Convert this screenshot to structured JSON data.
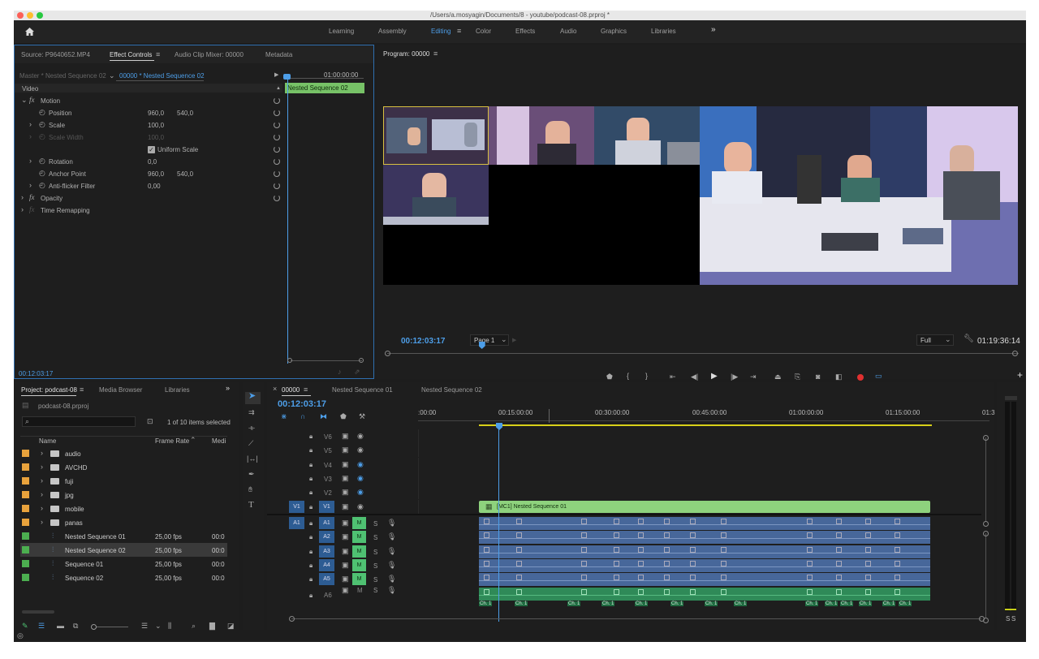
{
  "window": {
    "title": "/Users/a.mosyagin/Documents/8 - youtube/podcast-08.prproj *"
  },
  "workspaces": {
    "items": [
      "Learning",
      "Assembly",
      "Editing",
      "Color",
      "Effects",
      "Audio",
      "Graphics",
      "Libraries"
    ],
    "active": "Editing",
    "more": "»"
  },
  "source_panel": {
    "tabs": [
      "Source: P9640652.MP4",
      "Effect Controls",
      "Audio Clip Mixer: 00000",
      "Metadata"
    ],
    "active_tab": "Effect Controls",
    "master_label": "Master * Nested Sequence 02",
    "sequence_label": "00000 * Nested Sequence 02",
    "ruler_time": "01:00:00:00",
    "clip_label": "Nested Sequence 02",
    "video_header": "Video",
    "motion": "Motion",
    "properties": [
      {
        "name": "Position",
        "v1": "960,0",
        "v2": "540,0"
      },
      {
        "name": "Scale",
        "v1": "100,0",
        "v2": ""
      },
      {
        "name": "Scale Width",
        "v1": "100,0",
        "v2": ""
      },
      {
        "name": "Rotation",
        "v1": "0,0",
        "v2": ""
      },
      {
        "name": "Anchor Point",
        "v1": "960,0",
        "v2": "540,0"
      },
      {
        "name": "Anti-flicker Filter",
        "v1": "0,00",
        "v2": ""
      }
    ],
    "uniform_scale": "Uniform Scale",
    "opacity": "Opacity",
    "time_remapping": "Time Remapping",
    "timecode": "00:12:03:17"
  },
  "program_monitor": {
    "title": "Program: 00000",
    "timecode": "00:12:03:17",
    "page": "Page 1",
    "zoom": "Full",
    "duration": "01:19:36:14",
    "playhead_fraction": 0.15
  },
  "project_panel": {
    "tabs": [
      "Project: podcast-08",
      "Media Browser",
      "Libraries"
    ],
    "project_file": "podcast-08.prproj",
    "selection": "1 of 10 items selected",
    "columns": [
      "Name",
      "Frame Rate",
      "Medi"
    ],
    "items": [
      {
        "name": "audio",
        "type": "folder",
        "color": "#e8a23c",
        "fps": "",
        "media": ""
      },
      {
        "name": "AVCHD",
        "type": "folder",
        "color": "#e8a23c",
        "fps": "",
        "media": ""
      },
      {
        "name": "fuji",
        "type": "folder",
        "color": "#e8a23c",
        "fps": "",
        "media": ""
      },
      {
        "name": "jpg",
        "type": "folder",
        "color": "#e8a23c",
        "fps": "",
        "media": ""
      },
      {
        "name": "mobile",
        "type": "folder",
        "color": "#e8a23c",
        "fps": "",
        "media": ""
      },
      {
        "name": "panas",
        "type": "folder",
        "color": "#e8a23c",
        "fps": "",
        "media": ""
      },
      {
        "name": "Nested Sequence 01",
        "type": "sequence",
        "color": "#4caf50",
        "fps": "25,00 fps",
        "media": "00:0"
      },
      {
        "name": "Nested Sequence 02",
        "type": "sequence",
        "color": "#4caf50",
        "fps": "25,00 fps",
        "media": "00:0",
        "selected": true
      },
      {
        "name": "Sequence 01",
        "type": "sequence",
        "color": "#4caf50",
        "fps": "25,00 fps",
        "media": "00:0"
      },
      {
        "name": "Sequence 02",
        "type": "sequence",
        "color": "#4caf50",
        "fps": "25,00 fps",
        "media": "00:0"
      }
    ]
  },
  "timeline": {
    "tabs": [
      "00000",
      "Nested Sequence 01",
      "Nested Sequence 02"
    ],
    "active_tab": "00000",
    "timecode": "00:12:03:17",
    "ruler": [
      ":00:00",
      "00:15:00:00",
      "00:30:00:00",
      "00:45:00:00",
      "01:00:00:00",
      "01:15:00:00",
      "01:3"
    ],
    "video_tracks": [
      "V6",
      "V5",
      "V4",
      "V3",
      "V2",
      "V1"
    ],
    "audio_tracks": [
      "A1",
      "A2",
      "A3",
      "A4",
      "A5",
      "A6"
    ],
    "source_v": "V1",
    "source_a": "A1",
    "video_clip": "[MC1] Nested Sequence 01",
    "mute_label": "M",
    "solo_label": "S",
    "channel_label": "Ch. 1",
    "meter_labels": [
      "S",
      "S"
    ]
  },
  "colors": {
    "accent": "#4d9ee8",
    "video_clip": "#8ed27d",
    "audio_clip": "#47679a",
    "record": "#e03030"
  }
}
